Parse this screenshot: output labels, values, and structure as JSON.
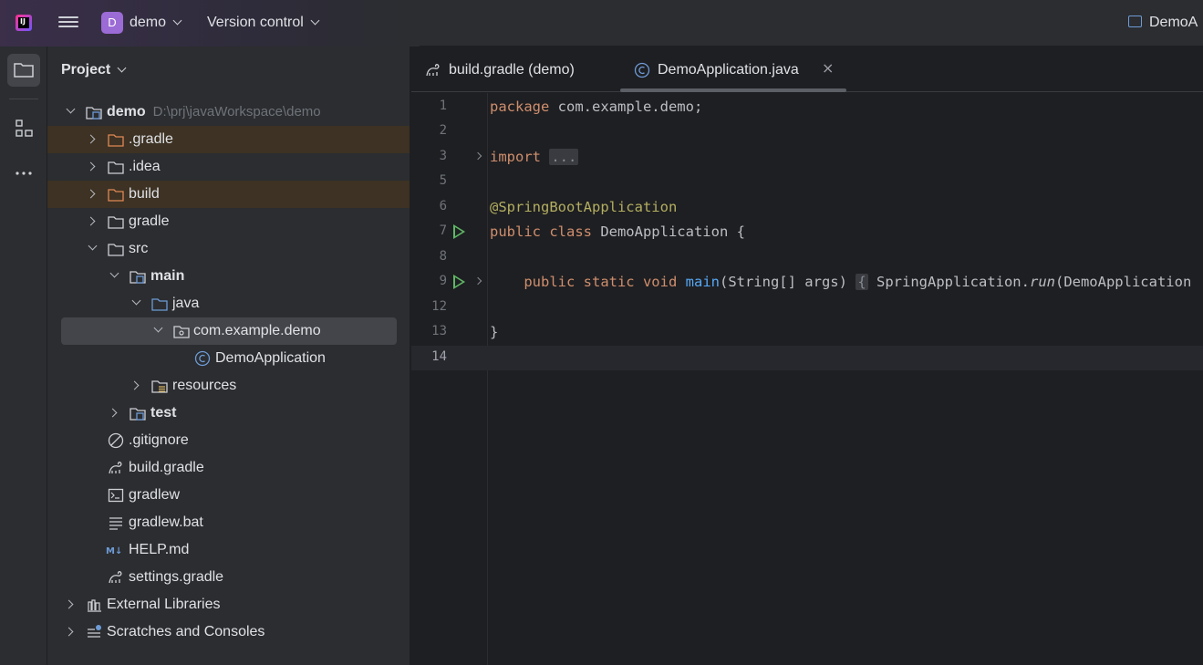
{
  "titlebar": {
    "project_badge": "D",
    "project_name": "demo",
    "vcs_menu": "Version control",
    "run_config": "DemoA"
  },
  "toolstrip": {
    "icons": [
      "folder-icon",
      "structure-icon",
      "more-icon"
    ]
  },
  "project_panel": {
    "title": "Project",
    "tree": [
      {
        "label": "demo",
        "path": "D:\\prj\\javaWorkspace\\demo",
        "icon": "module-folder-icon"
      },
      {
        "label": ".gradle",
        "icon": "excluded-folder-icon"
      },
      {
        "label": ".idea",
        "icon": "folder-icon"
      },
      {
        "label": "build",
        "icon": "excluded-folder-icon"
      },
      {
        "label": "gradle",
        "icon": "folder-icon"
      },
      {
        "label": "src",
        "icon": "folder-icon"
      },
      {
        "label": "main",
        "icon": "module-folder-icon"
      },
      {
        "label": "java",
        "icon": "source-folder-icon"
      },
      {
        "label": "com.example.demo",
        "icon": "package-icon"
      },
      {
        "label": "DemoApplication",
        "icon": "java-class-icon"
      },
      {
        "label": "resources",
        "icon": "resources-folder-icon"
      },
      {
        "label": "test",
        "icon": "module-folder-icon"
      },
      {
        "label": ".gitignore",
        "icon": "ignore-file-icon"
      },
      {
        "label": "build.gradle",
        "icon": "gradle-icon"
      },
      {
        "label": "gradlew",
        "icon": "shell-script-icon"
      },
      {
        "label": "gradlew.bat",
        "icon": "text-file-icon"
      },
      {
        "label": "HELP.md",
        "icon": "markdown-icon"
      },
      {
        "label": "settings.gradle",
        "icon": "gradle-icon"
      },
      {
        "label": "External Libraries",
        "icon": "libraries-icon"
      },
      {
        "label": "Scratches and Consoles",
        "icon": "scratches-icon"
      }
    ]
  },
  "editor": {
    "tabs": [
      {
        "label": "build.gradle (demo)",
        "icon": "gradle-icon"
      },
      {
        "label": "DemoApplication.java",
        "icon": "java-class-icon",
        "close": "×"
      }
    ],
    "lines": [
      {
        "num": "1"
      },
      {
        "num": "2"
      },
      {
        "num": "3"
      },
      {
        "num": "5"
      },
      {
        "num": "6"
      },
      {
        "num": "7"
      },
      {
        "num": "8"
      },
      {
        "num": "9"
      },
      {
        "num": "12"
      },
      {
        "num": "13"
      },
      {
        "num": "14"
      }
    ],
    "code": {
      "l1_kw": "package",
      "l1_rest": " com.example.demo;",
      "l3_kw": "import",
      "l3_fold": "...",
      "l6_ann": "@SpringBootApplication",
      "l7_kw": "public class",
      "l7_rest": " DemoApplication {",
      "l9_kw": "public static void",
      "l9_fn": "main",
      "l9_rest": "(String[] args)",
      "l9_fold": "{",
      "l9_call": "SpringApplication.",
      "l9_run": "run",
      "l9_tail": "(DemoApplication",
      "l13": "}"
    }
  }
}
